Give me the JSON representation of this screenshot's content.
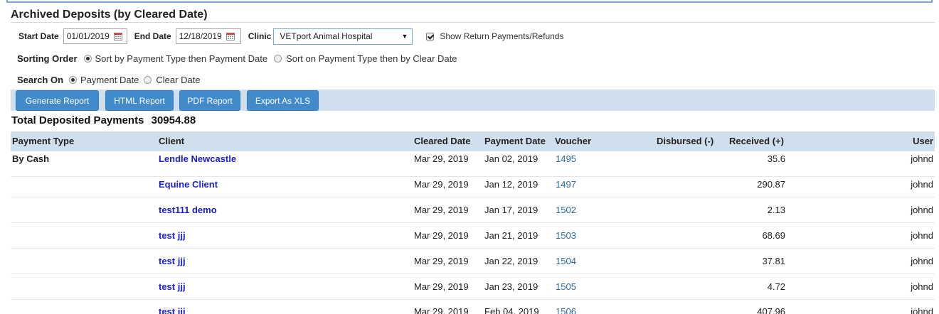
{
  "page": {
    "title": "Archived Deposits (by Cleared Date)"
  },
  "filters": {
    "start_date_label": "Start Date",
    "start_date_value": "01/01/2019",
    "end_date_label": "End Date",
    "end_date_value": "12/18/2019",
    "clinic_label": "Clinic",
    "clinic_value": "VETport Animal Hospital",
    "show_returns_label": "Show Return Payments/Refunds",
    "show_returns_checked": true,
    "sorting_label": "Sorting Order",
    "sort_option_1": "Sort by Payment Type then Payment Date",
    "sort_option_2": "Sort on Payment Type then by Clear Date",
    "search_on_label": "Search On",
    "search_option_1": "Payment Date",
    "search_option_2": "Clear Date"
  },
  "buttons": {
    "generate": "Generate Report",
    "html": "HTML Report",
    "pdf": "PDF Report",
    "xls": "Export As XLS"
  },
  "totals": {
    "label": "Total Deposited Payments",
    "value": "30954.88"
  },
  "table": {
    "headers": {
      "payment_type": "Payment Type",
      "client": "Client",
      "cleared_date": "Cleared Date",
      "payment_date": "Payment Date",
      "voucher": "Voucher",
      "disbursed": "Disbursed (-)",
      "received": "Received (+)",
      "user": "User"
    },
    "rows": [
      {
        "type": "By Cash",
        "client": "Lendle Newcastle",
        "cleared": "Mar 29, 2019",
        "paid": "Jan 02, 2019",
        "voucher": "1495",
        "received": "35.6",
        "user": "johnd"
      },
      {
        "type": "",
        "client": "Equine Client",
        "cleared": "Mar 29, 2019",
        "paid": "Jan 12, 2019",
        "voucher": "1497",
        "received": "290.87",
        "user": "johnd"
      },
      {
        "type": "",
        "client": "test111 demo",
        "cleared": "Mar 29, 2019",
        "paid": "Jan 17, 2019",
        "voucher": "1502",
        "received": "2.13",
        "user": "johnd"
      },
      {
        "type": "",
        "client": "test jjj",
        "cleared": "Mar 29, 2019",
        "paid": "Jan 21, 2019",
        "voucher": "1503",
        "received": "68.69",
        "user": "johnd"
      },
      {
        "type": "",
        "client": "test jjj",
        "cleared": "Mar 29, 2019",
        "paid": "Jan 22, 2019",
        "voucher": "1504",
        "received": "37.81",
        "user": "johnd"
      },
      {
        "type": "",
        "client": "test jjj",
        "cleared": "Mar 29, 2019",
        "paid": "Jan 23, 2019",
        "voucher": "1505",
        "received": "4.72",
        "user": "johnd"
      },
      {
        "type": "",
        "client": "test jjj",
        "cleared": "Mar 29, 2019",
        "paid": "Feb 04, 2019",
        "voucher": "1506",
        "received": "407.96",
        "user": "johnd"
      }
    ]
  },
  "colors": {
    "accent": "#428bca",
    "header_band": "#cfdfee",
    "link": "#1a1fd0"
  }
}
